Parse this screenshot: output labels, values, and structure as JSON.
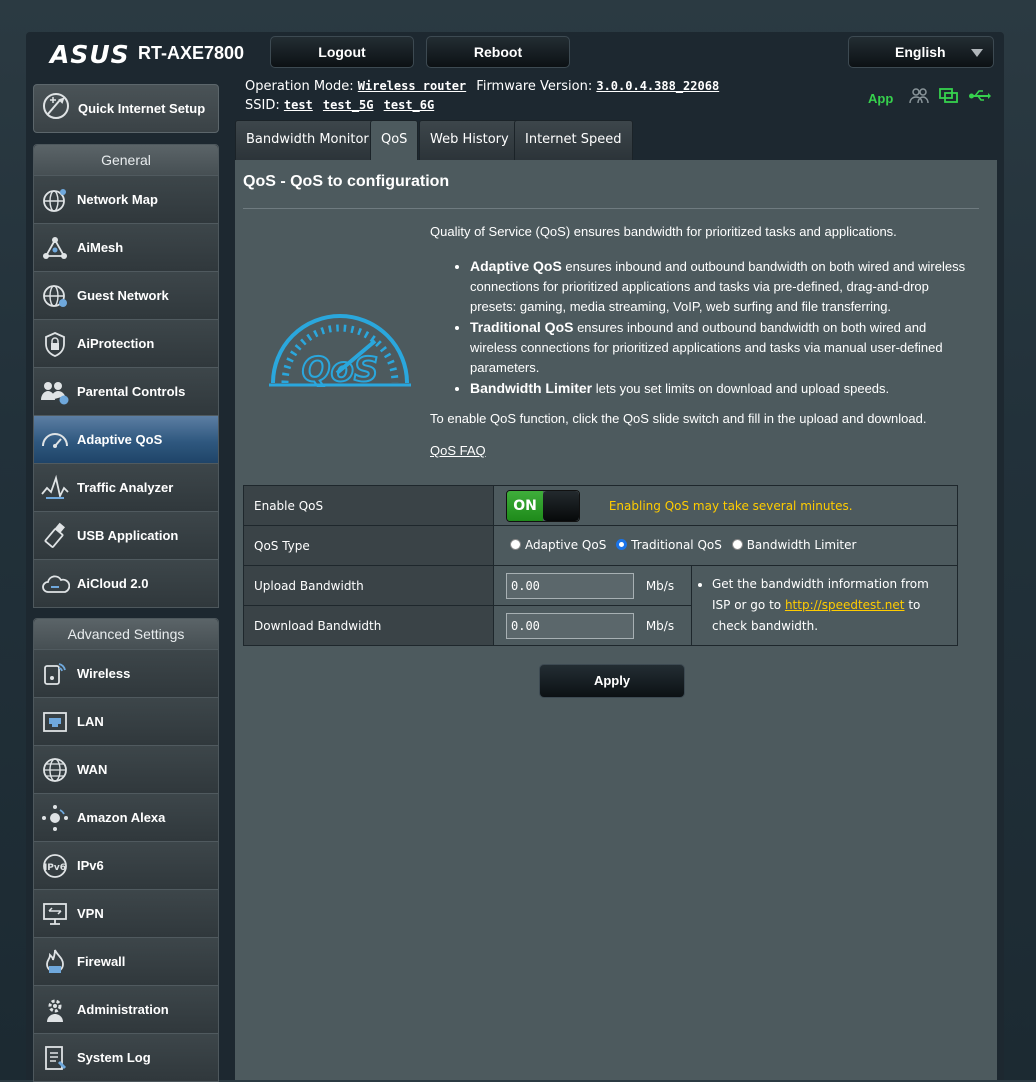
{
  "header": {
    "brand": "ASUS",
    "model": "RT-AXE7800",
    "logout_label": "Logout",
    "reboot_label": "Reboot",
    "language": "English"
  },
  "info": {
    "operation_mode_label": "Operation Mode:",
    "operation_mode": "Wireless router",
    "firmware_label": "Firmware Version:",
    "firmware": "3.0.0.4.388_22068",
    "ssid_label": "SSID:",
    "ssids": [
      "test",
      "test_5G",
      "test_6G"
    ],
    "app_label": "App"
  },
  "sidebar": {
    "quick_setup": "Quick Internet Setup",
    "general_header": "General",
    "general_items": [
      {
        "label": "Network Map",
        "icon": "globe-network-icon"
      },
      {
        "label": "AiMesh",
        "icon": "aimesh-icon"
      },
      {
        "label": "Guest Network",
        "icon": "guest-globe-icon"
      },
      {
        "label": "AiProtection",
        "icon": "shield-lock-icon"
      },
      {
        "label": "Parental Controls",
        "icon": "family-icon"
      },
      {
        "label": "Adaptive QoS",
        "icon": "speedometer-icon"
      },
      {
        "label": "Traffic Analyzer",
        "icon": "traffic-wave-icon"
      },
      {
        "label": "USB Application",
        "icon": "usb-stick-icon"
      },
      {
        "label": "AiCloud 2.0",
        "icon": "cloud-icon"
      }
    ],
    "advanced_header": "Advanced Settings",
    "advanced_items": [
      {
        "label": "Wireless",
        "icon": "wireless-icon"
      },
      {
        "label": "LAN",
        "icon": "lan-port-icon"
      },
      {
        "label": "WAN",
        "icon": "globe-icon"
      },
      {
        "label": "Amazon Alexa",
        "icon": "alexa-icon"
      },
      {
        "label": "IPv6",
        "icon": "ipv6-icon"
      },
      {
        "label": "VPN",
        "icon": "vpn-icon"
      },
      {
        "label": "Firewall",
        "icon": "firewall-icon"
      },
      {
        "label": "Administration",
        "icon": "gear-icon"
      },
      {
        "label": "System Log",
        "icon": "log-icon"
      }
    ]
  },
  "tabs": [
    "Bandwidth Monitor",
    "QoS",
    "Web History",
    "Internet Speed"
  ],
  "main": {
    "title": "QoS - QoS to configuration",
    "intro": "Quality of Service (QoS) ensures bandwidth for prioritized tasks and applications.",
    "bullets": [
      {
        "bold": "Adaptive QoS",
        "text": " ensures inbound and outbound bandwidth on both wired and wireless connections for prioritized applications and tasks via pre-defined, drag-and-drop presets: gaming, media streaming, VoIP, web surfing and file transferring."
      },
      {
        "bold": "Traditional QoS",
        "text": " ensures inbound and outbound bandwidth on both wired and wireless connections for prioritized applications and tasks via manual user-defined parameters."
      },
      {
        "bold": "Bandwidth Limiter",
        "text": " lets you set limits on download and upload speeds."
      }
    ],
    "enable_hint": "To enable QoS function, click the QoS slide switch and fill in the upload and download.",
    "faq": "QoS FAQ",
    "logo_text": "QoS"
  },
  "form": {
    "enable_label": "Enable QoS",
    "toggle_on": "ON",
    "warning": "Enabling QoS may take several minutes.",
    "type_label": "QoS Type",
    "types": [
      {
        "label": "Adaptive QoS",
        "selected": false
      },
      {
        "label": "Traditional QoS",
        "selected": true
      },
      {
        "label": "Bandwidth Limiter",
        "selected": false
      }
    ],
    "upload_label": "Upload Bandwidth",
    "upload_value": "0.00",
    "download_label": "Download Bandwidth",
    "download_value": "0.00",
    "unit": "Mb/s",
    "tip_pre": "Get the bandwidth information from ISP or go to ",
    "tip_link": "http://speedtest.net",
    "tip_post": " to check bandwidth.",
    "apply_label": "Apply"
  },
  "colors": {
    "accent_green": "#36d14d",
    "warning": "#ffcc00",
    "active_nav": "#2f587f"
  }
}
